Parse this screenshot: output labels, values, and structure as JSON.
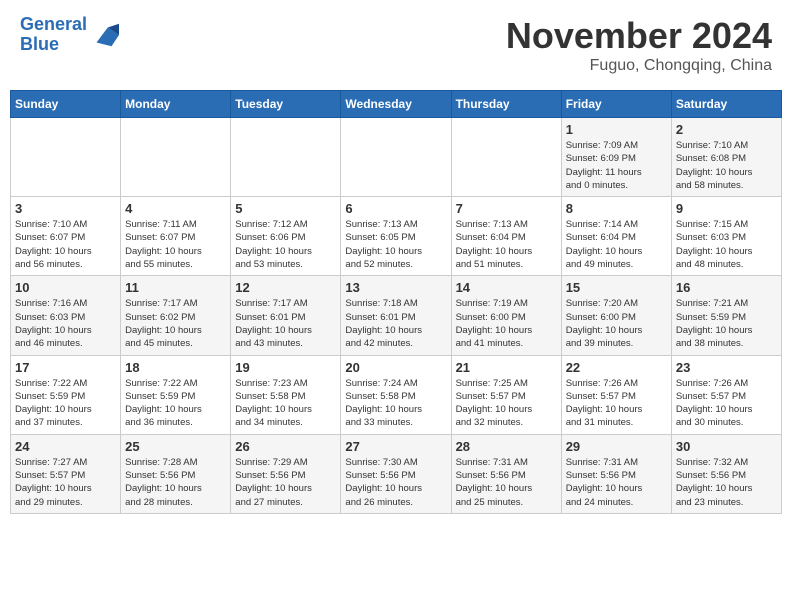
{
  "header": {
    "logo_line1": "General",
    "logo_line2": "Blue",
    "month": "November 2024",
    "location": "Fuguo, Chongqing, China"
  },
  "weekdays": [
    "Sunday",
    "Monday",
    "Tuesday",
    "Wednesday",
    "Thursday",
    "Friday",
    "Saturday"
  ],
  "weeks": [
    [
      {
        "day": "",
        "info": ""
      },
      {
        "day": "",
        "info": ""
      },
      {
        "day": "",
        "info": ""
      },
      {
        "day": "",
        "info": ""
      },
      {
        "day": "",
        "info": ""
      },
      {
        "day": "1",
        "info": "Sunrise: 7:09 AM\nSunset: 6:09 PM\nDaylight: 11 hours\nand 0 minutes."
      },
      {
        "day": "2",
        "info": "Sunrise: 7:10 AM\nSunset: 6:08 PM\nDaylight: 10 hours\nand 58 minutes."
      }
    ],
    [
      {
        "day": "3",
        "info": "Sunrise: 7:10 AM\nSunset: 6:07 PM\nDaylight: 10 hours\nand 56 minutes."
      },
      {
        "day": "4",
        "info": "Sunrise: 7:11 AM\nSunset: 6:07 PM\nDaylight: 10 hours\nand 55 minutes."
      },
      {
        "day": "5",
        "info": "Sunrise: 7:12 AM\nSunset: 6:06 PM\nDaylight: 10 hours\nand 53 minutes."
      },
      {
        "day": "6",
        "info": "Sunrise: 7:13 AM\nSunset: 6:05 PM\nDaylight: 10 hours\nand 52 minutes."
      },
      {
        "day": "7",
        "info": "Sunrise: 7:13 AM\nSunset: 6:04 PM\nDaylight: 10 hours\nand 51 minutes."
      },
      {
        "day": "8",
        "info": "Sunrise: 7:14 AM\nSunset: 6:04 PM\nDaylight: 10 hours\nand 49 minutes."
      },
      {
        "day": "9",
        "info": "Sunrise: 7:15 AM\nSunset: 6:03 PM\nDaylight: 10 hours\nand 48 minutes."
      }
    ],
    [
      {
        "day": "10",
        "info": "Sunrise: 7:16 AM\nSunset: 6:03 PM\nDaylight: 10 hours\nand 46 minutes."
      },
      {
        "day": "11",
        "info": "Sunrise: 7:17 AM\nSunset: 6:02 PM\nDaylight: 10 hours\nand 45 minutes."
      },
      {
        "day": "12",
        "info": "Sunrise: 7:17 AM\nSunset: 6:01 PM\nDaylight: 10 hours\nand 43 minutes."
      },
      {
        "day": "13",
        "info": "Sunrise: 7:18 AM\nSunset: 6:01 PM\nDaylight: 10 hours\nand 42 minutes."
      },
      {
        "day": "14",
        "info": "Sunrise: 7:19 AM\nSunset: 6:00 PM\nDaylight: 10 hours\nand 41 minutes."
      },
      {
        "day": "15",
        "info": "Sunrise: 7:20 AM\nSunset: 6:00 PM\nDaylight: 10 hours\nand 39 minutes."
      },
      {
        "day": "16",
        "info": "Sunrise: 7:21 AM\nSunset: 5:59 PM\nDaylight: 10 hours\nand 38 minutes."
      }
    ],
    [
      {
        "day": "17",
        "info": "Sunrise: 7:22 AM\nSunset: 5:59 PM\nDaylight: 10 hours\nand 37 minutes."
      },
      {
        "day": "18",
        "info": "Sunrise: 7:22 AM\nSunset: 5:59 PM\nDaylight: 10 hours\nand 36 minutes."
      },
      {
        "day": "19",
        "info": "Sunrise: 7:23 AM\nSunset: 5:58 PM\nDaylight: 10 hours\nand 34 minutes."
      },
      {
        "day": "20",
        "info": "Sunrise: 7:24 AM\nSunset: 5:58 PM\nDaylight: 10 hours\nand 33 minutes."
      },
      {
        "day": "21",
        "info": "Sunrise: 7:25 AM\nSunset: 5:57 PM\nDaylight: 10 hours\nand 32 minutes."
      },
      {
        "day": "22",
        "info": "Sunrise: 7:26 AM\nSunset: 5:57 PM\nDaylight: 10 hours\nand 31 minutes."
      },
      {
        "day": "23",
        "info": "Sunrise: 7:26 AM\nSunset: 5:57 PM\nDaylight: 10 hours\nand 30 minutes."
      }
    ],
    [
      {
        "day": "24",
        "info": "Sunrise: 7:27 AM\nSunset: 5:57 PM\nDaylight: 10 hours\nand 29 minutes."
      },
      {
        "day": "25",
        "info": "Sunrise: 7:28 AM\nSunset: 5:56 PM\nDaylight: 10 hours\nand 28 minutes."
      },
      {
        "day": "26",
        "info": "Sunrise: 7:29 AM\nSunset: 5:56 PM\nDaylight: 10 hours\nand 27 minutes."
      },
      {
        "day": "27",
        "info": "Sunrise: 7:30 AM\nSunset: 5:56 PM\nDaylight: 10 hours\nand 26 minutes."
      },
      {
        "day": "28",
        "info": "Sunrise: 7:31 AM\nSunset: 5:56 PM\nDaylight: 10 hours\nand 25 minutes."
      },
      {
        "day": "29",
        "info": "Sunrise: 7:31 AM\nSunset: 5:56 PM\nDaylight: 10 hours\nand 24 minutes."
      },
      {
        "day": "30",
        "info": "Sunrise: 7:32 AM\nSunset: 5:56 PM\nDaylight: 10 hours\nand 23 minutes."
      }
    ]
  ]
}
